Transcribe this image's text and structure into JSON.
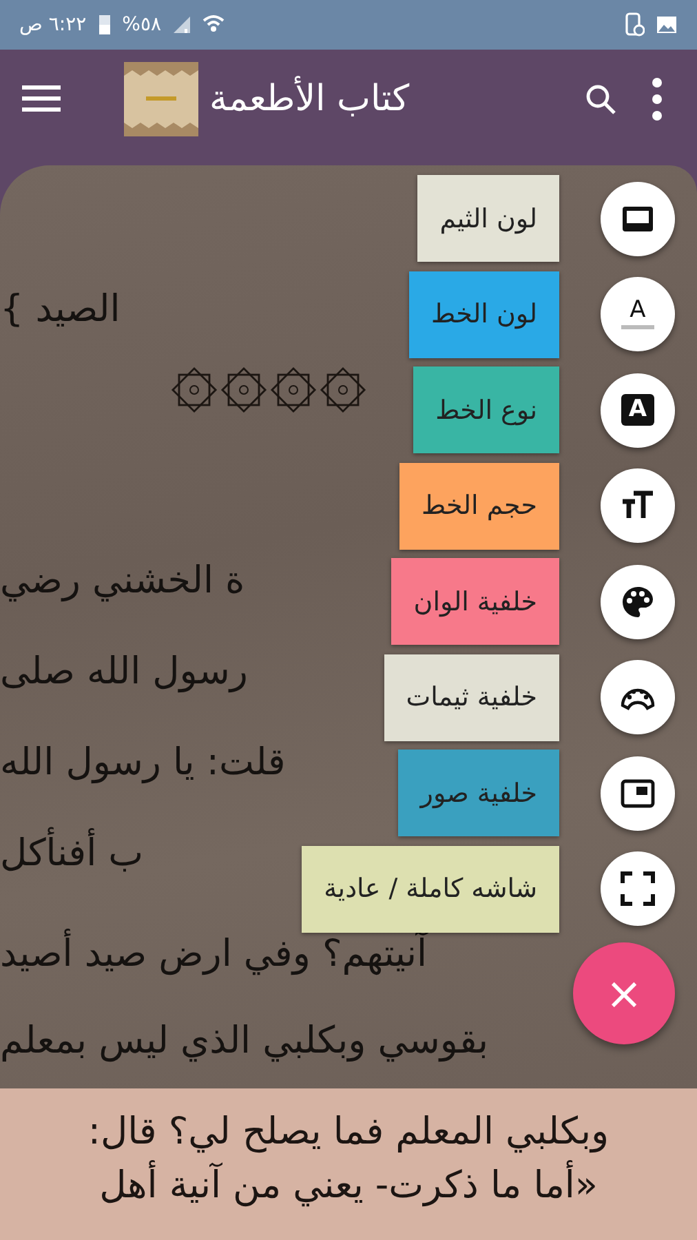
{
  "status_bar": {
    "time": "٦:٢٢ ص",
    "battery": "%٥٨"
  },
  "app_bar": {
    "title": "كتاب الأطعمة"
  },
  "reader": {
    "lines": [
      "الصيد }",
      "ة الخشني رضي",
      "رسول الله صلى",
      "قلت: يا رسول الله",
      "ب أفنأكل",
      "آنيتهم؟ وفي ارض صيد أصيد",
      "بقوسي وبكلبي الذي ليس بمعلم"
    ],
    "bottom_lines": [
      "وبكلبي المعلم فما يصلح لي؟ قال:",
      "«أما ما ذكرت- يعني من آنية أهل"
    ]
  },
  "menu": {
    "items": [
      {
        "label": "لون الثيم",
        "color": "#e3e2d5",
        "kind": "theme-color"
      },
      {
        "label": "لون الخط",
        "color": "#2aa9e6",
        "kind": "font-color",
        "icon_text": "A"
      },
      {
        "label": "نوع الخط",
        "color": "#39b5a4",
        "kind": "font-type",
        "icon_text": "A"
      },
      {
        "label": "حجم الخط",
        "color": "#fda35e",
        "kind": "font-size"
      },
      {
        "label": "خلفية الوان",
        "color": "#f7798a",
        "kind": "palette"
      },
      {
        "label": "خلفية ثيمات",
        "color": "#e1e0d3",
        "kind": "themes"
      },
      {
        "label": "خلفية صور",
        "color": "#3aa0bf",
        "kind": "picture"
      },
      {
        "label": "شاشه كاملة / عادية",
        "color": "#dde0b0",
        "kind": "fullscreen"
      }
    ]
  },
  "fab": {
    "label": "×"
  }
}
